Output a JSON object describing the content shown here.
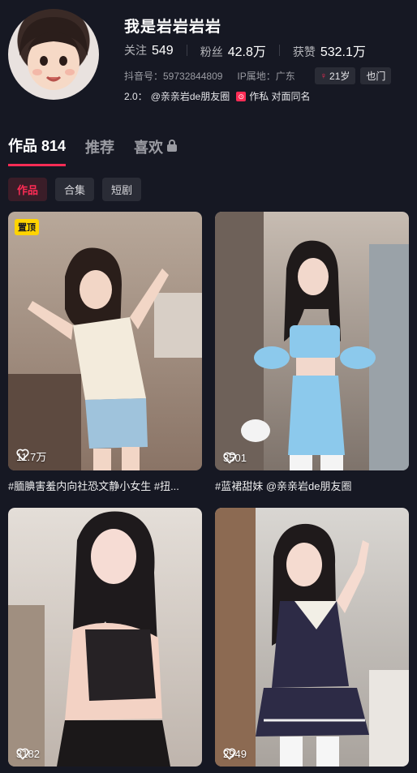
{
  "profile": {
    "name": "我是岩岩岩岩",
    "stats": [
      {
        "label": "关注",
        "value": "549"
      },
      {
        "label": "粉丝",
        "value": "42.8万"
      },
      {
        "label": "获赞",
        "value": "532.1万"
      }
    ],
    "douyin_id": "抖音号：59732844809",
    "ip_location": "IP属地：广东",
    "tags": [
      {
        "icon": "female-icon",
        "label": "21岁"
      },
      {
        "label": "也门"
      }
    ],
    "bio_prefix": "2.0：",
    "bio_mention": "@亲亲岩de朋友圈",
    "bio_badge": "作私 对面同名"
  },
  "tabs": [
    {
      "label": "作品 814",
      "active": true
    },
    {
      "label": "推荐",
      "active": false
    },
    {
      "label": "喜欢",
      "active": false,
      "locked": true
    }
  ],
  "subtabs": [
    {
      "label": "作品",
      "active": true
    },
    {
      "label": "合集",
      "active": false
    },
    {
      "label": "短剧",
      "active": false
    }
  ],
  "videos": [
    {
      "pinned_label": "置顶",
      "likes": "11.7万",
      "caption": "#腼腆害羞内向社恐文静小女生 #扭..."
    },
    {
      "likes": "3501",
      "caption": "#蓝裙甜妹 @亲亲岩de朋友圈"
    },
    {
      "likes": "3182",
      "caption": ""
    },
    {
      "likes": "2949",
      "caption": ""
    }
  ],
  "colors": {
    "background": "#161823",
    "accent": "#fe2c55",
    "pinned_badge": "#ffd400",
    "muted_text": "#9a9ba2"
  }
}
